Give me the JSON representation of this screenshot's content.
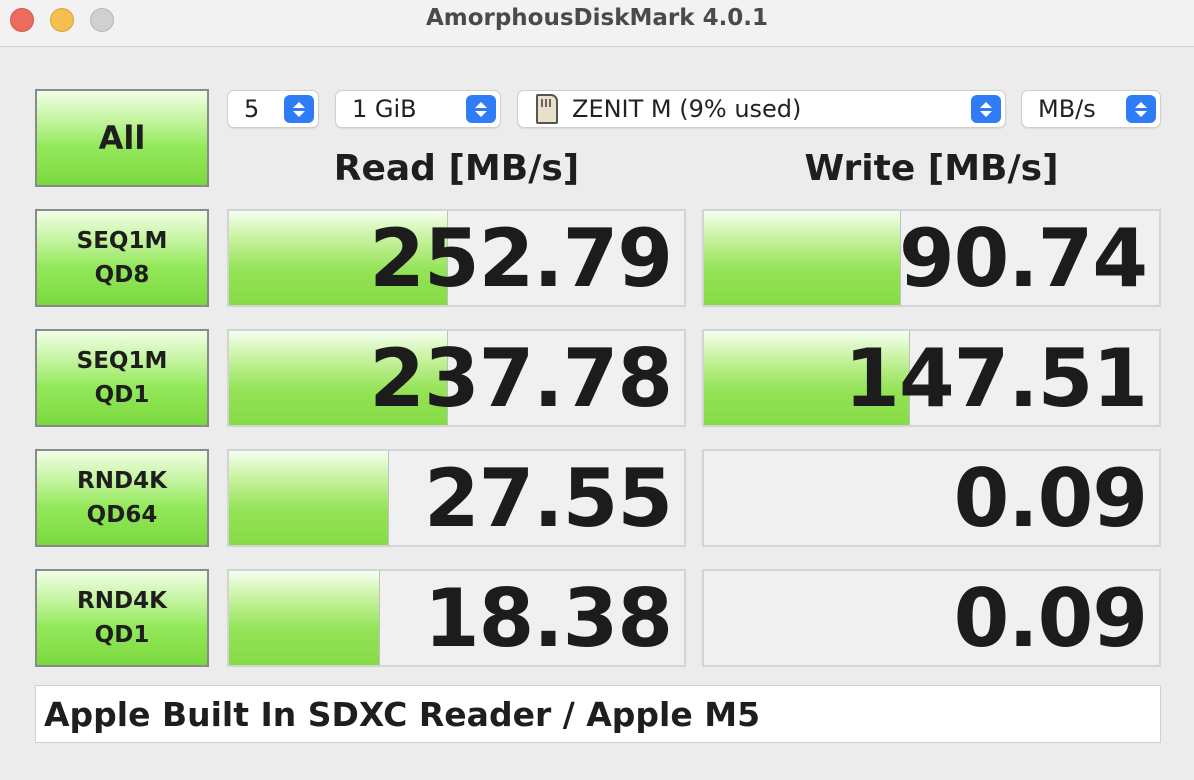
{
  "window": {
    "title": "AmorphousDiskMark 4.0.1"
  },
  "controls": {
    "all_label": "All",
    "count": "5",
    "size": "1 GiB",
    "drive": "ZENIT M (9% used)",
    "unit": "MB/s"
  },
  "headers": {
    "read": "Read [MB/s]",
    "write": "Write [MB/s]"
  },
  "tests": [
    {
      "line1": "SEQ1M",
      "line2": "QD8",
      "read": "252.79",
      "write": "90.74",
      "read_fill": 0.48,
      "write_fill": 0.43
    },
    {
      "line1": "SEQ1M",
      "line2": "QD1",
      "read": "237.78",
      "write": "147.51",
      "read_fill": 0.48,
      "write_fill": 0.45
    },
    {
      "line1": "RND4K",
      "line2": "QD64",
      "read": "27.55",
      "write": "0.09",
      "read_fill": 0.35,
      "write_fill": 0.0
    },
    {
      "line1": "RND4K",
      "line2": "QD1",
      "read": "18.38",
      "write": "0.09",
      "read_fill": 0.33,
      "write_fill": 0.0
    }
  ],
  "footer": {
    "comment": "Apple Built In SDXC Reader / Apple M5"
  }
}
